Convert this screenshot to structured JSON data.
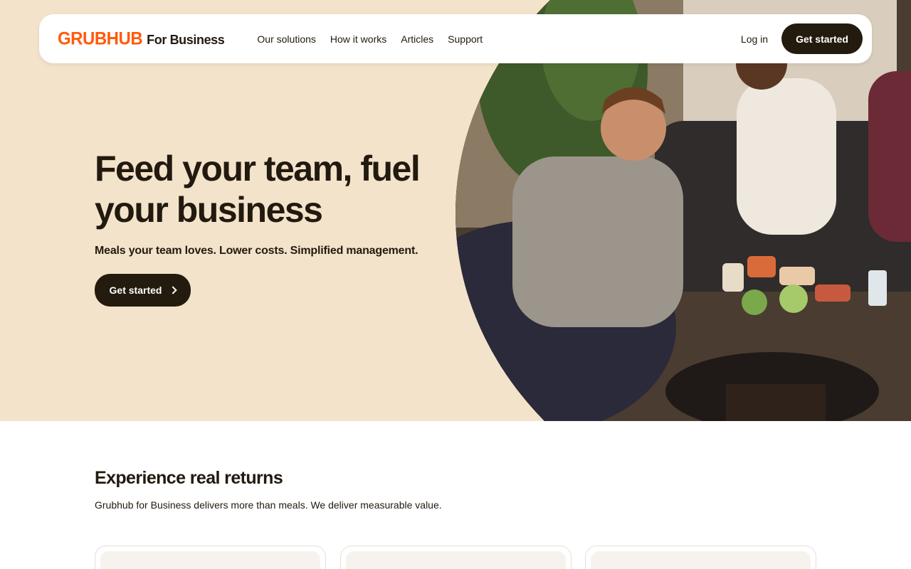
{
  "nav": {
    "brand": "GRUBHUB",
    "brand_sub": "For Business",
    "links": [
      "Our solutions",
      "How it works",
      "Articles",
      "Support"
    ],
    "login": "Log in",
    "cta": "Get started"
  },
  "hero": {
    "headline": "Feed your team, fuel your business",
    "subline": "Meals your team loves. Lower costs. Simplified management.",
    "cta": "Get started"
  },
  "returns": {
    "title": "Experience real returns",
    "subtitle": "Grubhub for Business delivers more than meals. We deliver measurable value."
  },
  "colors": {
    "brand_orange": "#ff5a0a",
    "hero_bg": "#f3e3cb",
    "dark_button": "#241b0f"
  },
  "icons": {
    "hero_cta": "chevron-right-icon"
  }
}
